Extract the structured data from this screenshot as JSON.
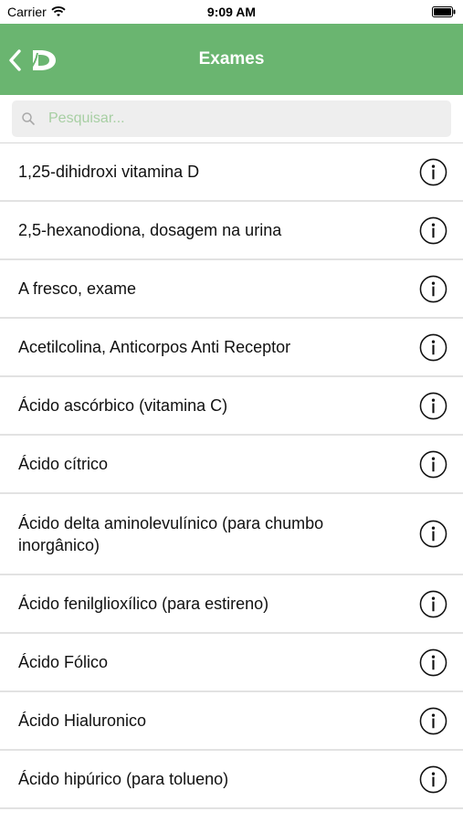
{
  "status_bar": {
    "carrier": "Carrier",
    "time": "9:09 AM"
  },
  "nav": {
    "title": "Exames",
    "logo": "D",
    "accent": "#6ab570"
  },
  "search": {
    "placeholder": "Pesquisar...",
    "value": ""
  },
  "items": [
    {
      "label": "1,25-dihidroxi vitamina D"
    },
    {
      "label": "2,5-hexanodiona, dosagem na urina"
    },
    {
      "label": "A fresco, exame"
    },
    {
      "label": "Acetilcolina, Anticorpos Anti Receptor"
    },
    {
      "label": "Ácido ascórbico (vitamina C)"
    },
    {
      "label": "Ácido cítrico"
    },
    {
      "label": "Ácido delta aminolevulínico (para chumbo inorgânico)"
    },
    {
      "label": "Ácido fenilglioxílico (para estireno)"
    },
    {
      "label": "Ácido Fólico"
    },
    {
      "label": "Ácido Hialuronico"
    },
    {
      "label": "Ácido hipúrico (para tolueno)"
    }
  ]
}
